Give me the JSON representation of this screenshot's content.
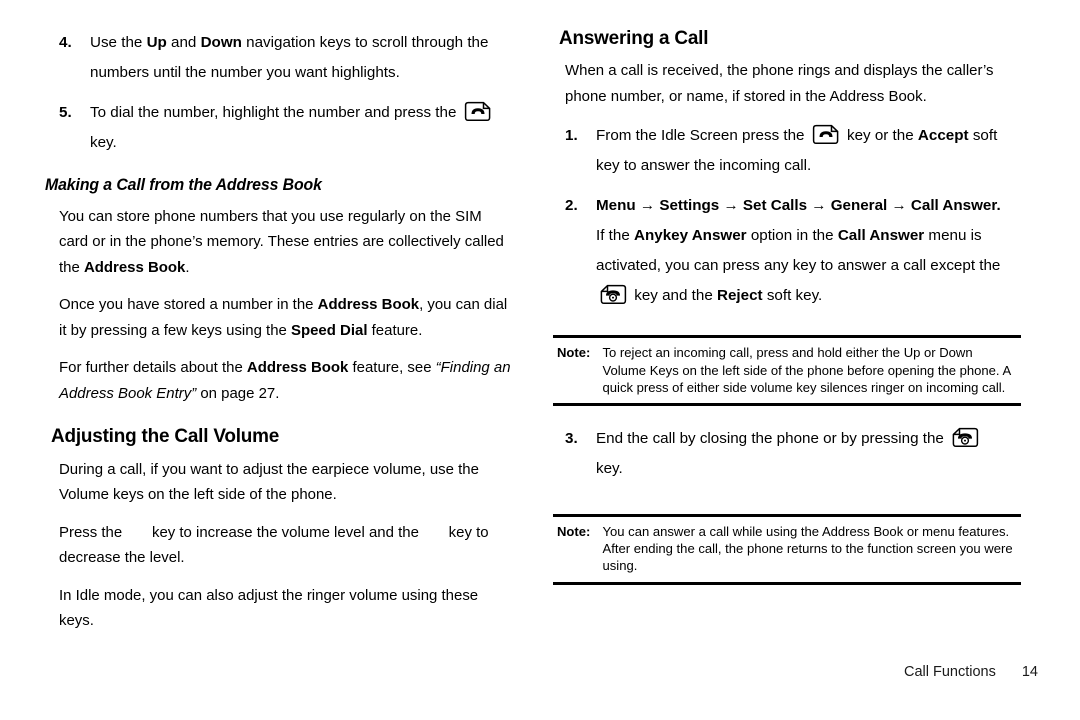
{
  "document": {
    "type": "mobile-phone-user-manual-page",
    "footer": {
      "section": "Call Functions",
      "page_number": "14"
    }
  },
  "left_column": {
    "steps_continued": [
      {
        "num": "4.",
        "parts": [
          {
            "t": "Use the ",
            "s": "normal"
          },
          {
            "t": "Up",
            "s": "bold"
          },
          {
            "t": " and ",
            "s": "normal"
          },
          {
            "t": "Down",
            "s": "bold"
          },
          {
            "t": " navigation keys to scroll through the numbers until the number you want highlights.",
            "s": "normal"
          }
        ],
        "text": "Use the Up and Down navigation keys to scroll through the numbers until the number you want highlights."
      },
      {
        "num": "5.",
        "text": "To dial the number, highlight the number and press the",
        "icon": "send-call-key-icon",
        "text_after": "key."
      }
    ],
    "subheading": "Making a Call from the Address Book",
    "paragraphs": [
      {
        "text": "You can store phone numbers that you use regularly on the SIM card or in the phone’s memory. These entries are collectively called the Address Book.",
        "emphasis": [
          "Address Book"
        ]
      },
      {
        "text": "Once you have stored a number in the Address Book, you can dial it by pressing a few keys using the Speed Dial feature.",
        "emphasis": [
          "Address Book",
          "Speed Dial"
        ]
      },
      {
        "text": "For further details about the Address Book feature, see “Finding an Address Book Entry” on page 27.",
        "emphasis": [
          "Address Book"
        ],
        "italic": "“Finding an Address Book Entry”"
      }
    ],
    "heading": "Adjusting the Call Volume",
    "volume_paragraphs": [
      "During a call, if you want to adjust the earpiece volume, use the Volume keys on the left side of the phone.",
      "Press the    key to increase the volume level and the    key to decrease the level.",
      "In Idle mode, you can also adjust the ringer volume using these keys."
    ]
  },
  "right_column": {
    "heading": "Answering a Call",
    "intro": "When a call is received, the phone rings and displays the caller’s phone number, or name, if stored in the Address Book.",
    "steps": [
      {
        "num": "1.",
        "pre": "From the Idle Screen press the",
        "icon": "send-call-key-icon",
        "post_a": "key or the",
        "post_bold": "Accept",
        "post_b": "soft key to answer the incoming call."
      },
      {
        "num": "2.",
        "menu_path": "Menu → Settings → Set Calls → General → Call Answer.",
        "menu_items": [
          "Menu",
          "Settings",
          "Set Calls",
          "General",
          "Call Answer"
        ],
        "arrow": "→",
        "body_pre": "If the",
        "body_bold_1": "Anykey Answer",
        "body_mid_1": "option in the",
        "body_bold_2": "Call Answer",
        "body_mid_2": "menu is activated, you can press any key to answer a call except the",
        "icon": "end-call-key-icon",
        "body_mid_3": "key and the",
        "body_bold_3": "Reject",
        "body_end": "soft key."
      },
      {
        "num": "3.",
        "pre": "End the call by closing the phone or by pressing the",
        "icon": "end-call-key-icon",
        "post": "key."
      }
    ],
    "notes": [
      {
        "label": "Note:",
        "text": "To reject an incoming call, press and hold either the Up or Down Volume Keys on the left side of the phone before opening the phone. A quick press of either side volume key silences ringer on incoming call."
      },
      {
        "label": "Note:",
        "text": "You can answer a call while using the Address Book or menu features. After ending the call, the phone returns to the function screen you were using."
      }
    ]
  },
  "colors": {
    "text": "#000000",
    "background": "#ffffff",
    "rule": "#000000",
    "footer_text": "#1a1a1a"
  }
}
